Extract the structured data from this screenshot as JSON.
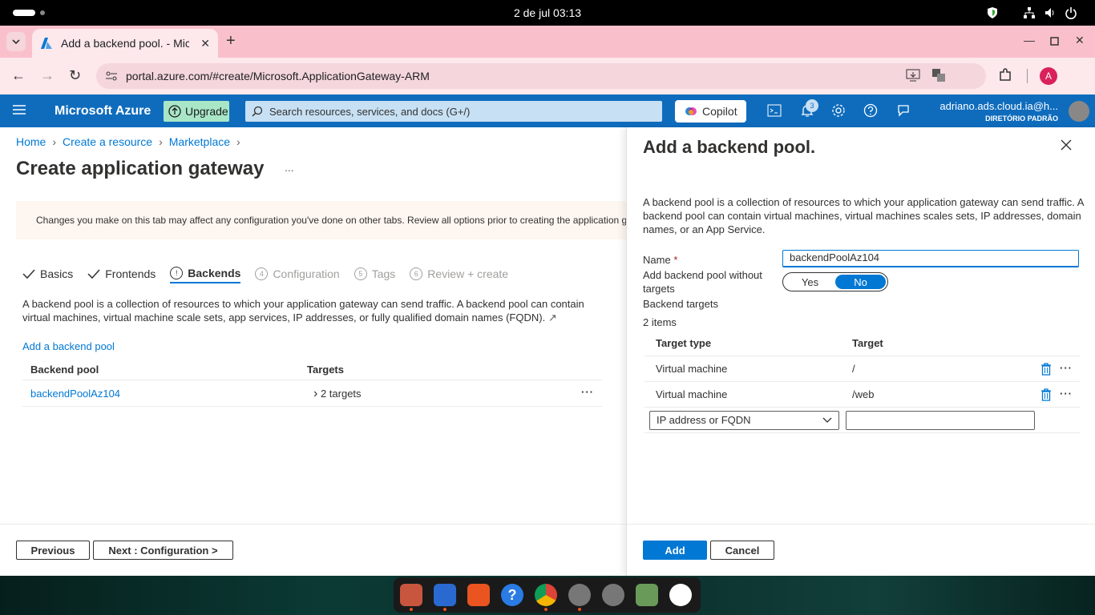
{
  "system": {
    "clock": "2 de jul  03:13"
  },
  "browser": {
    "tab_title": "Add a backend pool. - Micro",
    "url": "portal.azure.com/#create/Microsoft.ApplicationGateway-ARM",
    "profile_initial": "A"
  },
  "azure": {
    "brand": "Microsoft Azure",
    "upgrade": "Upgrade",
    "search_placeholder": "Search resources, services, and docs (G+/)",
    "copilot": "Copilot",
    "notifications_count": "3",
    "user": "adriano.ads.cloud.ia@h...",
    "directory": "DIRETÓRIO PADRÃO"
  },
  "page": {
    "breadcrumb": [
      "Home",
      "Create a resource",
      "Marketplace"
    ],
    "title": "Create application gateway",
    "ellipsis": "...",
    "warning": "Changes you make on this tab may affect any configuration you've done on other tabs. Review all options prior to creating the application gateway.",
    "steps": [
      {
        "label": "Basics",
        "state": "done"
      },
      {
        "label": "Frontends",
        "state": "done"
      },
      {
        "label": "Backends",
        "state": "active",
        "num": "!"
      },
      {
        "label": "Configuration",
        "state": "todo",
        "num": "4"
      },
      {
        "label": "Tags",
        "state": "todo",
        "num": "5"
      },
      {
        "label": "Review + create",
        "state": "todo",
        "num": "6"
      }
    ],
    "description": "A backend pool is a collection of resources to which your application gateway can send traffic. A backend pool can contain virtual machines, virtual machine scale sets, app services, IP addresses, or fully qualified domain names (FQDN).",
    "add_link": "Add a backend pool",
    "table": {
      "headers": [
        "Backend pool",
        "Targets"
      ],
      "rows": [
        {
          "pool": "backendPoolAz104",
          "targets": "2 targets"
        }
      ]
    },
    "previous": "Previous",
    "next": "Next : Configuration >"
  },
  "panel": {
    "title": "Add a backend pool.",
    "description": "A backend pool is a collection of resources to which your application gateway can send traffic. A backend pool can contain virtual machines, virtual machines scales sets, IP addresses, domain names, or an App Service.",
    "name_label": "Name",
    "name_required": "*",
    "name_value": "backendPoolAz104",
    "without_targets_label": "Add backend pool without targets",
    "toggle_yes": "Yes",
    "toggle_no": "No",
    "toggle_selected": "No",
    "targets_label": "Backend targets",
    "items_count": "2 items",
    "headers": [
      "Target type",
      "Target"
    ],
    "rows": [
      {
        "type": "Virtual machine",
        "target": "/"
      },
      {
        "type": "Virtual machine",
        "target": "/web"
      }
    ],
    "new_row_type": "IP address or FQDN",
    "new_row_target": "",
    "add": "Add",
    "cancel": "Cancel"
  }
}
